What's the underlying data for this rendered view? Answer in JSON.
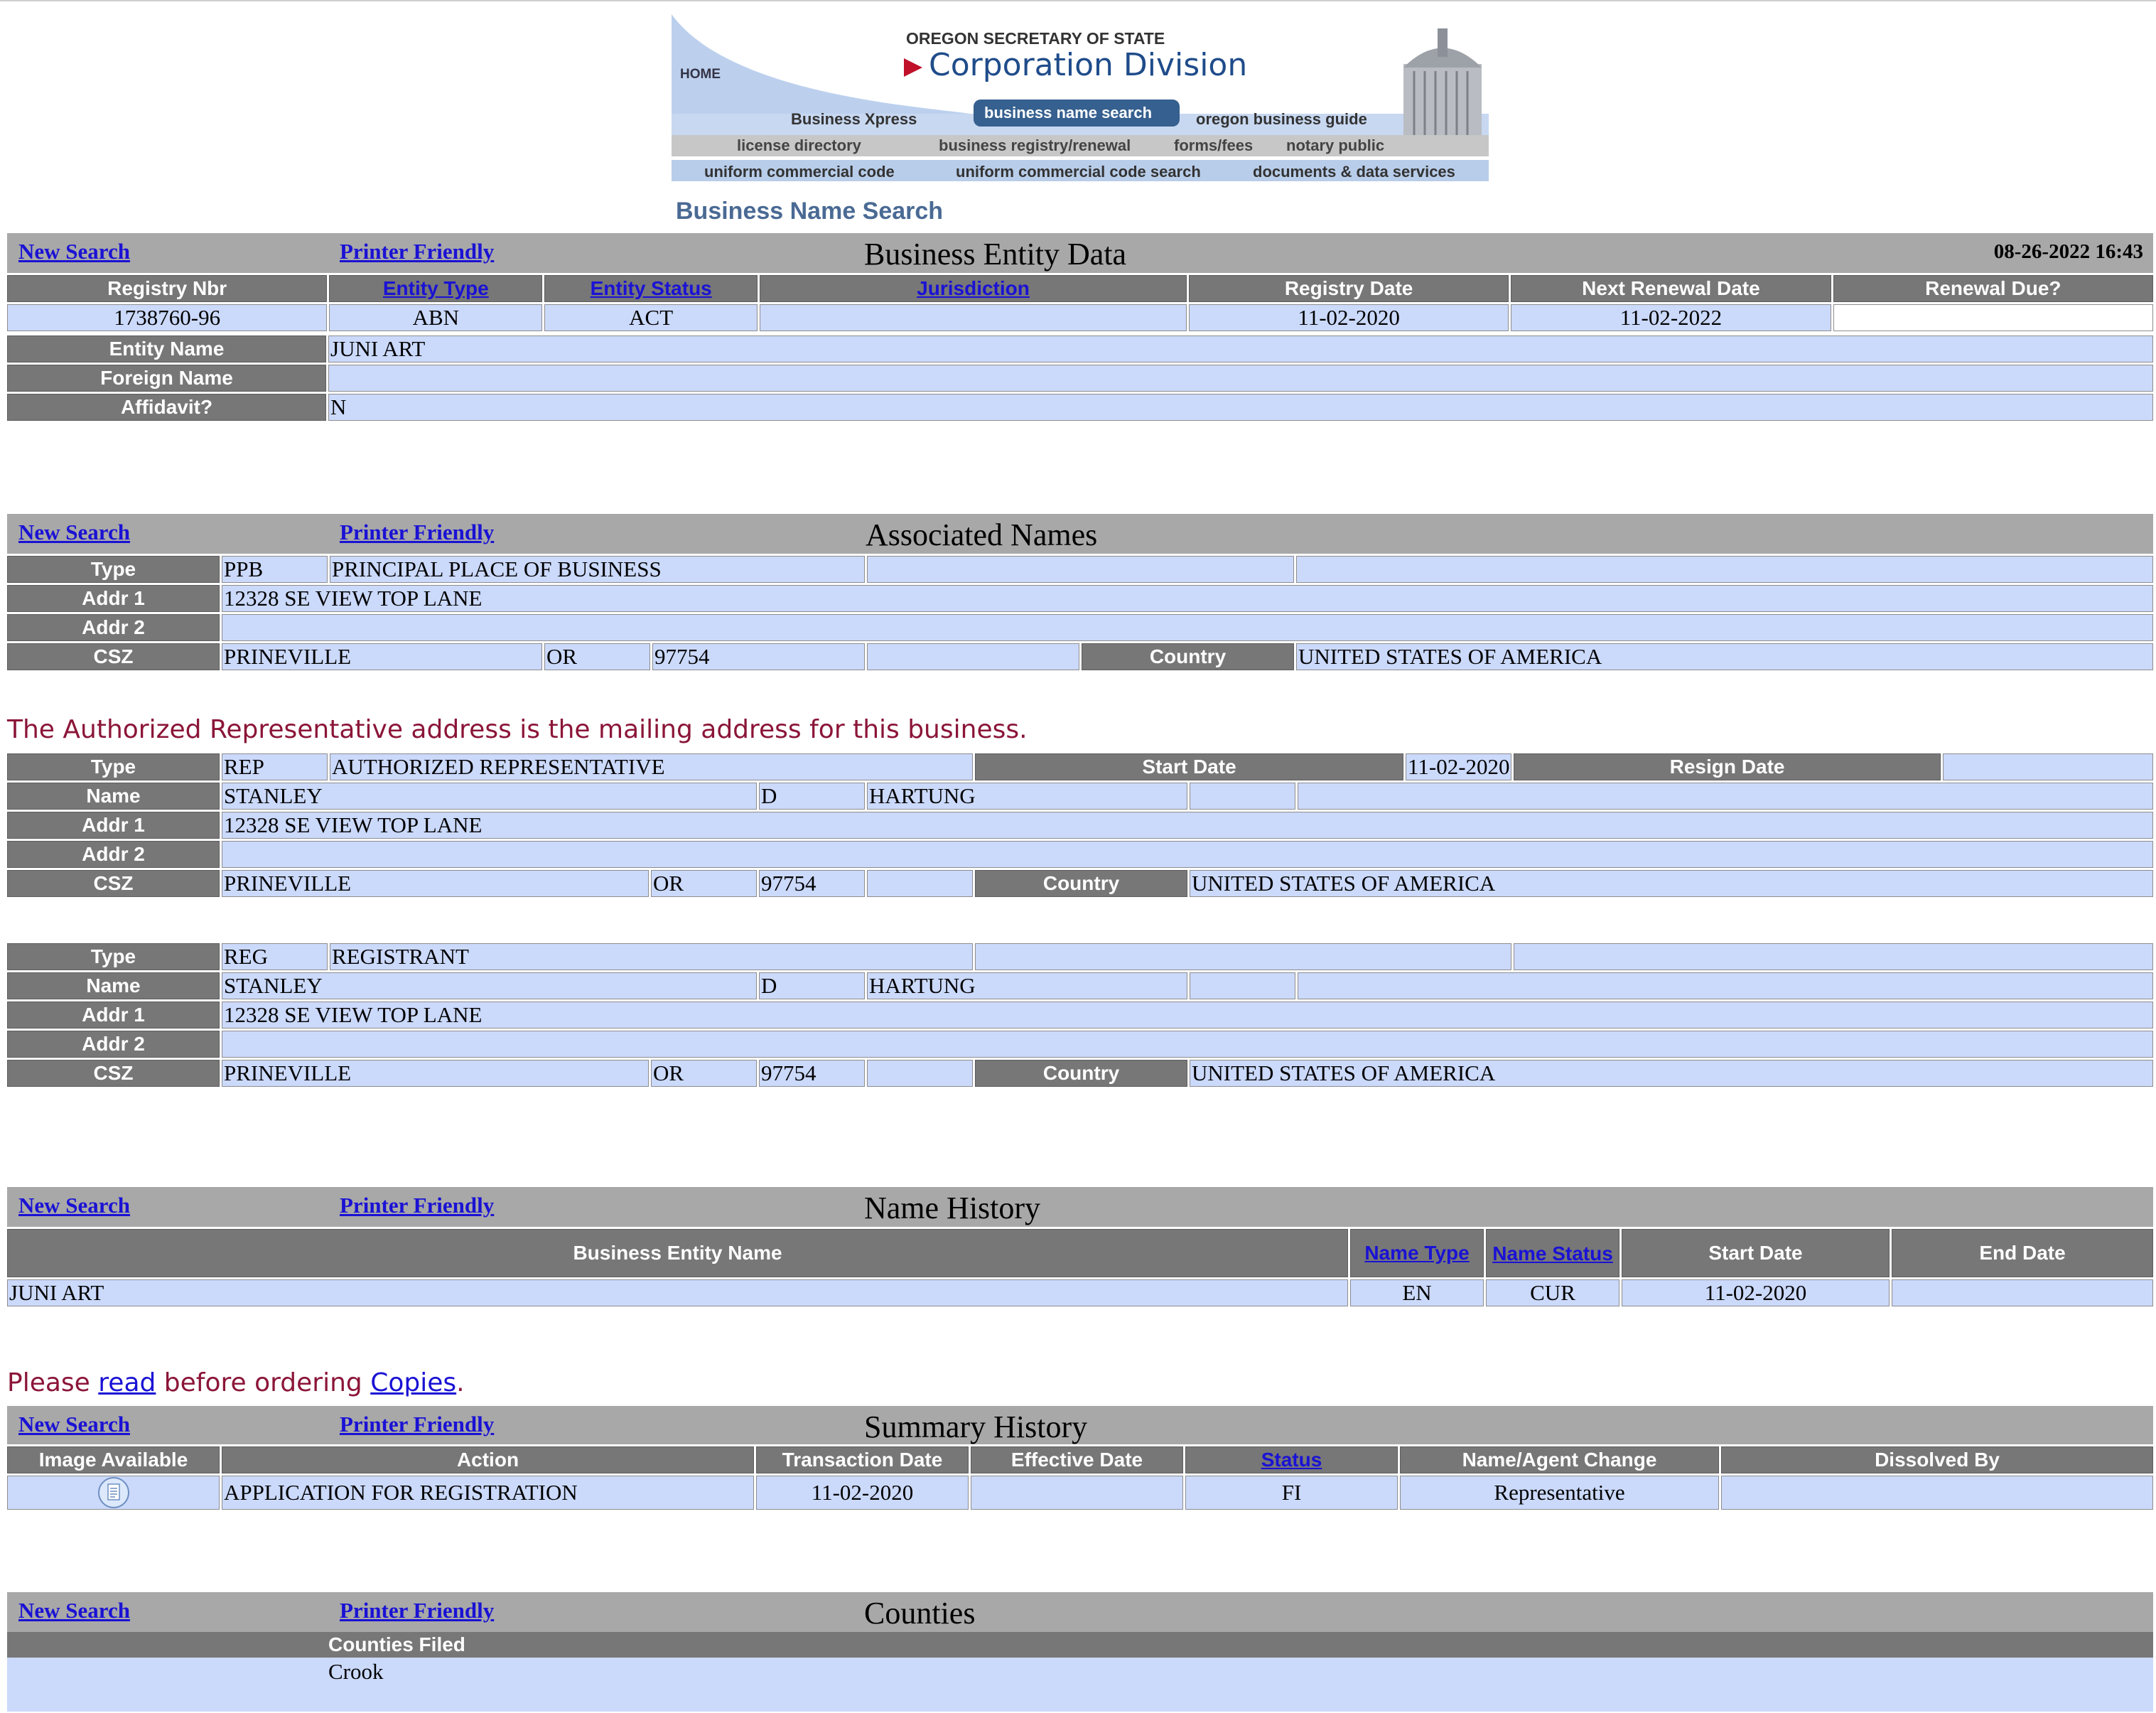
{
  "banner": {
    "home": "HOME",
    "agency_small": "OREGON SECRETARY OF STATE",
    "agency_large": "Corporation Division",
    "nav_row1": [
      "Business Xpress",
      "business name search",
      "oregon business guide"
    ],
    "nav_row2": [
      "license directory",
      "business registry/renewal",
      "forms/fees",
      "notary public"
    ],
    "nav_row3": [
      "uniform commercial code",
      "uniform commercial code search",
      "documents & data services"
    ]
  },
  "page_heading": "Business Name Search",
  "common": {
    "new_search": "New Search",
    "printer_friendly": "Printer Friendly"
  },
  "entity": {
    "title": "Business Entity Data",
    "timestamp": "08-26-2022 16:43",
    "headers": [
      "Registry Nbr",
      "Entity Type",
      "Entity Status",
      "Jurisdiction",
      "Registry Date",
      "Next Renewal Date",
      "Renewal Due?"
    ],
    "values": [
      "1738760-96",
      "ABN",
      "ACT",
      "",
      "11-02-2020",
      "11-02-2022",
      ""
    ],
    "name_label": "Entity Name",
    "name": "JUNI ART",
    "foreign_label": "Foreign Name",
    "foreign": "",
    "affidavit_label": "Affidavit?",
    "affidavit": "N"
  },
  "associated": {
    "title": "Associated Names",
    "labels": {
      "type": "Type",
      "name": "Name",
      "addr1": "Addr 1",
      "addr2": "Addr 2",
      "csz": "CSZ",
      "country": "Country",
      "start_date": "Start Date",
      "resign_date": "Resign Date"
    },
    "ppb": {
      "code": "PPB",
      "desc": "PRINCIPAL PLACE OF BUSINESS",
      "addr1": "12328 SE VIEW TOP LANE",
      "addr2": "",
      "city": "PRINEVILLE",
      "state": "OR",
      "zip": "97754",
      "country": "UNITED STATES OF AMERICA"
    },
    "notice": "The Authorized Representative address is the mailing address for this business.",
    "rep": {
      "code": "REP",
      "desc": "AUTHORIZED REPRESENTATIVE",
      "start_date": "11-02-2020",
      "resign_date": "",
      "first": "STANLEY",
      "middle": "D",
      "last": "HARTUNG",
      "addr1": "12328 SE VIEW TOP LANE",
      "addr2": "",
      "city": "PRINEVILLE",
      "state": "OR",
      "zip": "97754",
      "country": "UNITED STATES OF AMERICA"
    },
    "reg": {
      "code": "REG",
      "desc": "REGISTRANT",
      "first": "STANLEY",
      "middle": "D",
      "last": "HARTUNG",
      "addr1": "12328 SE VIEW TOP LANE",
      "addr2": "",
      "city": "PRINEVILLE",
      "state": "OR",
      "zip": "97754",
      "country": "UNITED STATES OF AMERICA"
    }
  },
  "name_history": {
    "title": "Name History",
    "headers": [
      "Business Entity Name",
      "Name Type",
      "Name Status",
      "Start Date",
      "End Date"
    ],
    "rows": [
      [
        "JUNI ART",
        "EN",
        "CUR",
        "11-02-2020",
        ""
      ]
    ]
  },
  "copies_notice": {
    "pre": "Please ",
    "read": "read",
    "mid": " before ordering ",
    "copies": "Copies",
    "post": "."
  },
  "summary": {
    "title": "Summary History",
    "headers": [
      "Image Available",
      "Action",
      "Transaction Date",
      "Effective Date",
      "Status",
      "Name/Agent Change",
      "Dissolved By"
    ],
    "rows": [
      {
        "image_icon": "document-icon",
        "action": "APPLICATION FOR REGISTRATION",
        "transaction_date": "11-02-2020",
        "effective_date": "",
        "status": "FI",
        "name_agent_change": "Representative",
        "dissolved_by": ""
      }
    ]
  },
  "counties": {
    "title": "Counties",
    "filed_label": "Counties Filed",
    "filed": "Crook"
  },
  "colors": {
    "header_bg": "#777777",
    "title_bg": "#a8a8a8",
    "cell_bg": "#cbd9fb",
    "link": "#1a12d4",
    "notice": "#8b1538"
  }
}
